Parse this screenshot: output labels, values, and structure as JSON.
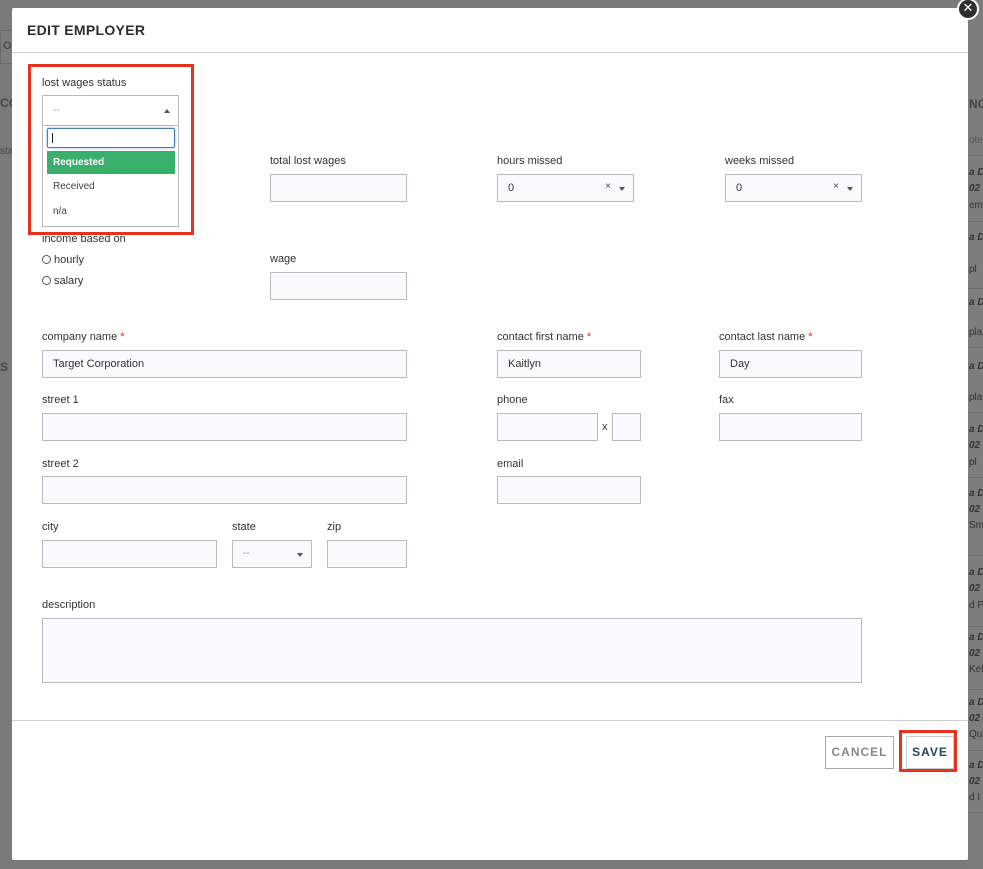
{
  "modal": {
    "title": "EDIT EMPLOYER",
    "close_icon": "close-icon"
  },
  "background": {
    "left_tab_text": "OY",
    "left_text_1": "CO",
    "left_text_2": "sta",
    "left_text_3": "S",
    "right_heading": "NOT",
    "right_sub": "ote",
    "right_entries": [
      "a D",
      "02",
      "emp",
      "a D",
      "pl",
      "a D",
      "pla",
      "a D",
      "pla",
      "a D",
      "02",
      "pl",
      "a D",
      "02",
      "Smi",
      "a D",
      "02",
      "d Pl",
      "a D",
      "02",
      "Kell",
      "a D",
      "02",
      "Qui",
      "a D",
      "02",
      "d I"
    ]
  },
  "lost_wages_status": {
    "label": "lost wages status",
    "selected": "--",
    "search_value": "",
    "options": [
      "Requested",
      "Received",
      "n/a"
    ],
    "highlighted_option": "Requested"
  },
  "total_lost_wages": {
    "label": "total lost wages",
    "value": ""
  },
  "hours_missed": {
    "label": "hours missed",
    "value": "0",
    "clear": "×"
  },
  "weeks_missed": {
    "label": "weeks missed",
    "value": "0",
    "clear": "×"
  },
  "income_based_on": {
    "label": "income based on",
    "options": [
      "hourly",
      "salary"
    ]
  },
  "wage": {
    "label": "wage",
    "value": ""
  },
  "company_name": {
    "label": "company name",
    "required": "*",
    "value": "Target Corporation"
  },
  "contact_first_name": {
    "label": "contact first name",
    "required": "*",
    "value": "Kaitlyn"
  },
  "contact_last_name": {
    "label": "contact last name",
    "required": "*",
    "value": "Day"
  },
  "street1": {
    "label": "street 1",
    "value": ""
  },
  "phone": {
    "label": "phone",
    "value": "",
    "ext_sep": "x",
    "ext_value": ""
  },
  "fax": {
    "label": "fax",
    "value": ""
  },
  "street2": {
    "label": "street 2",
    "value": ""
  },
  "email": {
    "label": "email",
    "value": ""
  },
  "city": {
    "label": "city",
    "value": ""
  },
  "state": {
    "label": "state",
    "value": "--"
  },
  "zip": {
    "label": "zip",
    "value": ""
  },
  "description": {
    "label": "description",
    "value": ""
  },
  "buttons": {
    "cancel": "CANCEL",
    "save": "SAVE"
  },
  "colors": {
    "highlight": "#e8321c",
    "active_option": "#3aae6b",
    "save_text": "#21485a"
  }
}
